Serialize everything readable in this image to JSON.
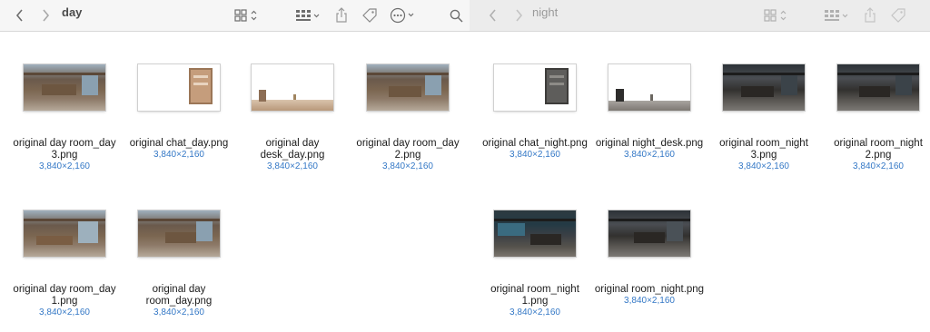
{
  "left_window": {
    "title": "day",
    "files": [
      {
        "name": "original day room_day 3.png",
        "size": "3,840×2,160"
      },
      {
        "name": "original chat_day.png",
        "size": "3,840×2,160"
      },
      {
        "name": "original day desk_day.png",
        "size": "3,840×2,160"
      },
      {
        "name": "original day room_day 2.png",
        "size": "3,840×2,160"
      },
      {
        "name": "original day room_day 1.png",
        "size": "3,840×2,160"
      },
      {
        "name": "original day room_day.png",
        "size": "3,840×2,160"
      }
    ]
  },
  "right_window": {
    "title": "night",
    "files": [
      {
        "name": "original chat_night.png",
        "size": "3,840×2,160"
      },
      {
        "name": "original night_desk.png",
        "size": "3,840×2,160"
      },
      {
        "name": "original room_night 3.png",
        "size": "3,840×2,160"
      },
      {
        "name": "original room_night 2.png",
        "size": "3,840×2,160"
      },
      {
        "name": "original room_night 1.png",
        "size": "3,840×2,160"
      },
      {
        "name": "original room_night.png",
        "size": "3,840×2,160"
      }
    ]
  },
  "toolbar_icons": [
    "back-icon",
    "forward-icon",
    "icon-view-icon",
    "group-by-icon",
    "share-icon",
    "tag-icon",
    "more-actions-icon",
    "search-icon"
  ],
  "colors": {
    "size_text": "#3478c6",
    "toolbar_bg": "#f6f6f6"
  }
}
